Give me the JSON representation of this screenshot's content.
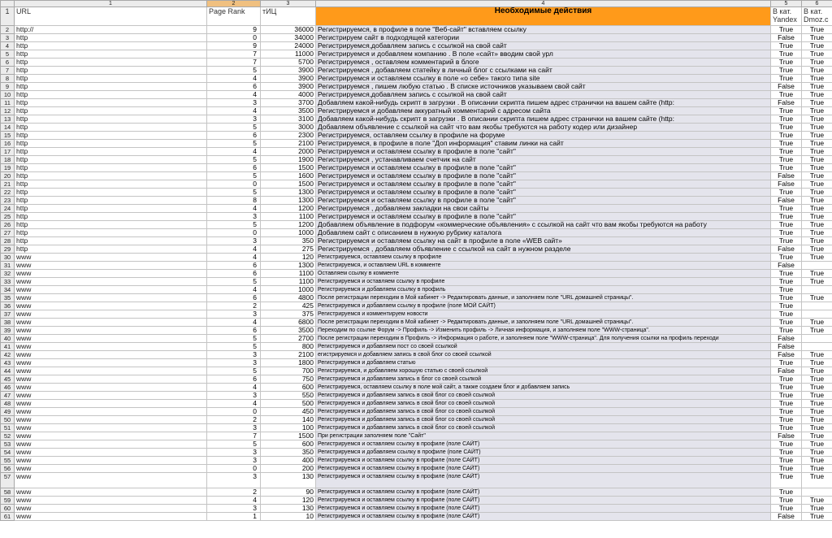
{
  "column_numbers": [
    "1",
    "2",
    "3",
    "4",
    "5",
    "6"
  ],
  "headers": {
    "url": "URL",
    "pagerank": "Page Rank",
    "tic": "тИЦ",
    "actions": "Необходимые действия",
    "yandex": "В кат. Yandex",
    "dmoz": "В кат. Dmoz.c"
  },
  "rows": [
    {
      "n": "2",
      "url": "http://",
      "pr": "9",
      "tic": "36000",
      "act": "Регистрируемся, в профиле в поле \"Веб-сайт\" вставляем ссылку",
      "y": "True",
      "d": "True",
      "small": false
    },
    {
      "n": "3",
      "url": "http",
      "pr": "0",
      "tic": "34000",
      "act": "Регистрируем сайт в подходящей категории",
      "y": "False",
      "d": "True",
      "small": false
    },
    {
      "n": "4",
      "url": "http",
      "pr": "9",
      "tic": "24000",
      "act": "Регистрируемся,добавляем запись с ссылкой на свой сайт",
      "y": "True",
      "d": "True",
      "small": false
    },
    {
      "n": "5",
      "url": "http",
      "pr": "7",
      "tic": "11000",
      "act": "Регистрируемся и добавляем компанию . В поле «сайт» вводим свой урл",
      "y": "True",
      "d": "True",
      "small": false
    },
    {
      "n": "6",
      "url": "http",
      "pr": "7",
      "tic": "5700",
      "act": "Регистрируемся , оставляем комментарий в блоге",
      "y": "True",
      "d": "True",
      "small": false
    },
    {
      "n": "7",
      "url": "http",
      "pr": "5",
      "tic": "3900",
      "act": "Регистрируемся , добавляем статейку в личный блог с ссылками на сайт",
      "y": "True",
      "d": "True",
      "small": false
    },
    {
      "n": "8",
      "url": "http",
      "pr": "4",
      "tic": "3900",
      "act": "Регистрируемся и оставляем ссылку в поле «о себе» такого типа site",
      "y": "True",
      "d": "True",
      "small": false
    },
    {
      "n": "9",
      "url": "http",
      "pr": "6",
      "tic": "3900",
      "act": "Регистрируемся , пишем любую статью . В списке источников указываем свой сайт",
      "y": "False",
      "d": "True",
      "small": false
    },
    {
      "n": "10",
      "url": "http",
      "pr": "4",
      "tic": "4000",
      "act": " Регистрируемся,добавляем запись с ссылкой на свой сайт",
      "y": "True",
      "d": "True",
      "small": false
    },
    {
      "n": "11",
      "url": "http",
      "pr": "3",
      "tic": "3700",
      "act": "Добавляем какой-нибудь скрипт в загрузки . В описании скрипта пишем адрес странички на вашем сайте (http:",
      "y": "False",
      "d": "True",
      "small": false
    },
    {
      "n": "12",
      "url": "http",
      "pr": "4",
      "tic": "3500",
      "act": "Регистрируемся и добавляем аккуратный комментарий с адресом сайта",
      "y": "True",
      "d": "True",
      "small": false
    },
    {
      "n": "13",
      "url": "http",
      "pr": "3",
      "tic": "3100",
      "act": "Добавляем какой-нибудь скрипт в загрузки . В описании скрипта пишем адрес странички на вашем сайте (http:",
      "y": "True",
      "d": "True",
      "small": false
    },
    {
      "n": "14",
      "url": "http",
      "pr": "5",
      "tic": "3000",
      "act": "Добавляем объявление с ссылкой на сайт что вам якобы требуются на работу кодер или дизайнер",
      "y": "True",
      "d": "True",
      "small": false
    },
    {
      "n": "15",
      "url": "http",
      "pr": "6",
      "tic": "2300",
      "act": "Регистрируемся, оставляем ссылку в профиле на форуме",
      "y": "True",
      "d": "True",
      "small": false
    },
    {
      "n": "16",
      "url": "http",
      "pr": "5",
      "tic": "2100",
      "act": "Регистрируемся, в профиле в поле \"Доп информация\" ставим линки на сайт",
      "y": "True",
      "d": "True",
      "small": false
    },
    {
      "n": "17",
      "url": "http",
      "pr": "4",
      "tic": "2000",
      "act": "Регистрируемся и оставляем ссылку в профиле в поле \"сайт\"",
      "y": "True",
      "d": "True",
      "small": false
    },
    {
      "n": "18",
      "url": "http",
      "pr": "5",
      "tic": "1900",
      "act": "Регистрируемся , устанавливаем счетчик на сайт",
      "y": "True",
      "d": "True",
      "small": false
    },
    {
      "n": "19",
      "url": "http",
      "pr": "6",
      "tic": "1500",
      "act": "Регистрируемся и оставляем ссылку в профиле в поле \"сайт\"",
      "y": "True",
      "d": "True",
      "small": false
    },
    {
      "n": "20",
      "url": "http",
      "pr": "5",
      "tic": "1600",
      "act": " Регистрируемся и оставляем ссылку в профиле в поле \"сайт\"",
      "y": "False",
      "d": "True",
      "small": false
    },
    {
      "n": "21",
      "url": "http",
      "pr": "0",
      "tic": "1500",
      "act": "Регистрируемся и оставляем ссылку в профиле в поле \"сайт\"",
      "y": "False",
      "d": "True",
      "small": false
    },
    {
      "n": "22",
      "url": "http",
      "pr": "5",
      "tic": "1300",
      "act": "Регистрируемся и оставляем ссылку в профиле в поле \"сайт\"",
      "y": "True",
      "d": "True",
      "small": false
    },
    {
      "n": "23",
      "url": "http",
      "pr": "8",
      "tic": "1300",
      "act": "Регистрируемся и оставляем ссылку в профиле в поле \"сайт\"",
      "y": "False",
      "d": "True",
      "small": false
    },
    {
      "n": "24",
      "url": "http",
      "pr": "4",
      "tic": "1200",
      "act": "Регистрируемся , добавляем закладки на свои сайты",
      "y": "True",
      "d": "True",
      "small": false
    },
    {
      "n": "25",
      "url": "http",
      "pr": "3",
      "tic": "1100",
      "act": "Регистрируемся и оставляем ссылку в профиле в поле \"сайт\"",
      "y": "True",
      "d": "True",
      "small": false
    },
    {
      "n": "26",
      "url": "http",
      "pr": "5",
      "tic": "1200",
      "act": "Добавляем объявление в подфорум «коммерческие объявления» с ссылкой на сайт что вам якобы требуются на работу",
      "y": "True",
      "d": "True",
      "small": false
    },
    {
      "n": "27",
      "url": "http",
      "pr": "0",
      "tic": "1000",
      "act": " Добавляем сайт с описанием в нужную рубрику каталога",
      "y": "True",
      "d": "True",
      "small": false
    },
    {
      "n": "28",
      "url": "http",
      "pr": "3",
      "tic": "350",
      "act": "Регистрируемся и оставляем ссылку на сайт в профиле в поле «WEB сайт»",
      "y": "True",
      "d": "True",
      "small": false
    },
    {
      "n": "29",
      "url": "http",
      "pr": "4",
      "tic": "275",
      "act": "Регистрируемся , добавляем объявление с ссылкой на сайт в нужном разделе",
      "y": "False",
      "d": "True",
      "small": false
    },
    {
      "n": "30",
      "url": "www",
      "pr": "4",
      "tic": "120",
      "act": "Регистрируемся, оставляем ссылку в профиле",
      "y": "True",
      "d": "True",
      "small": true
    },
    {
      "n": "31",
      "url": "www",
      "pr": "6",
      "tic": "1300",
      "act": "Регистрируемся, и оставляем URL в комменте",
      "y": "False",
      "d": "",
      "small": true
    },
    {
      "n": "32",
      "url": "www",
      "pr": "6",
      "tic": "1100",
      "act": "Оставляем ссылку в комменте",
      "y": "True",
      "d": "True",
      "small": true
    },
    {
      "n": "33",
      "url": "www",
      "pr": "5",
      "tic": "1100",
      "act": "Регистрируемся и оставляем ссылку в профиле",
      "y": "True",
      "d": "True",
      "small": true
    },
    {
      "n": "34",
      "url": "www",
      "pr": "4",
      "tic": "1000",
      "act": "Регистрируемся и добавляем ссылку в профиль",
      "y": "True",
      "d": "",
      "small": true
    },
    {
      "n": "35",
      "url": "www",
      "pr": "6",
      "tic": "4800",
      "act": "После регистрации переходим в Мой кабинет -> Редактировать данные, и заполняем поле \"URL домашней страницы\".",
      "y": "True",
      "d": "True",
      "small": true
    },
    {
      "n": "36",
      "url": "www",
      "pr": "2",
      "tic": "425",
      "act": "Регистрируемся и добавляем ссылку в профиле (поле МОЙ САЙТ)",
      "y": "True",
      "d": "",
      "small": true
    },
    {
      "n": "37",
      "url": "www",
      "pr": "3",
      "tic": "375",
      "act": "Регистрируемся и комментируем новости",
      "y": "True",
      "d": "",
      "small": true
    },
    {
      "n": "38",
      "url": "www",
      "pr": "4",
      "tic": "6800",
      "act": "После регистрации переходим в Мой кабинет -> Редактировать данные, и заполняем поле \"URL домашней страницы\".",
      "y": "True",
      "d": "True",
      "small": true
    },
    {
      "n": "39",
      "url": "www",
      "pr": "6",
      "tic": "3500",
      "act": "Переходим по ссылке Форум -> Профиль -> Изменить профиль -> Личная информация, и заполняем поле \"WWW-страница\".",
      "y": "True",
      "d": "True",
      "small": true
    },
    {
      "n": "40",
      "url": "www",
      "pr": "5",
      "tic": "2700",
      "act": "После регистрации переходим в Профиль -> Информация о работе, и заполняем поле \"WWW-страница\". Для получения ссылки на профиль переходи",
      "y": "False",
      "d": "",
      "small": true
    },
    {
      "n": "41",
      "url": "www",
      "pr": "5",
      "tic": "800",
      "act": "Регистрируемся и добавляем пост со своей ссылкой",
      "y": "False",
      "d": "",
      "small": true
    },
    {
      "n": "42",
      "url": "www",
      "pr": "3",
      "tic": "2100",
      "act": "егистрируемся и добавляем запись в свой блог со своей ссылкой",
      "y": "False",
      "d": "True",
      "small": true
    },
    {
      "n": "43",
      "url": "www",
      "pr": "3",
      "tic": "1800",
      "act": "Регистрируемся и добавляем статью",
      "y": "True",
      "d": "True",
      "small": true
    },
    {
      "n": "44",
      "url": "www",
      "pr": "5",
      "tic": "700",
      "act": "Регистрируемся, и добавляем хорошую статью с своей ссылкой",
      "y": "False",
      "d": "True",
      "small": true
    },
    {
      "n": "45",
      "url": "www",
      "pr": "6",
      "tic": "750",
      "act": "Регистрируемся и добавляем запись в блог со своей ссылкой",
      "y": "True",
      "d": "True",
      "small": true
    },
    {
      "n": "46",
      "url": "www",
      "pr": "4",
      "tic": "600",
      "act": "Регистрируемся, оставляем ссылку в поле мой сайт, а также создаем блог и добавляем запись",
      "y": "True",
      "d": "True",
      "small": true
    },
    {
      "n": "47",
      "url": "www",
      "pr": "3",
      "tic": "550",
      "act": "Регистрируемся и добавляем запись в свой блог со своей ссылкой",
      "y": "True",
      "d": "True",
      "small": true
    },
    {
      "n": "48",
      "url": "www",
      "pr": "4",
      "tic": "500",
      "act": "Регистрируемся и добавляем запись в свой блог со своей ссылкой",
      "y": "True",
      "d": "True",
      "small": true
    },
    {
      "n": "49",
      "url": "www",
      "pr": "0",
      "tic": "450",
      "act": "Регистрируемся и добавляем запись в свой блог со своей ссылкой",
      "y": "True",
      "d": "True",
      "small": true
    },
    {
      "n": "50",
      "url": "www",
      "pr": "2",
      "tic": "140",
      "act": "Регистрируемся и добавляем запись в свой блог со своей ссылкой",
      "y": "True",
      "d": "True",
      "small": true
    },
    {
      "n": "51",
      "url": "www",
      "pr": "3",
      "tic": "100",
      "act": "Регистрируемся и добавляем запись в свой блог со своей ссылкой",
      "y": "True",
      "d": "True",
      "small": true
    },
    {
      "n": "52",
      "url": "www",
      "pr": "7",
      "tic": "1500",
      "act": "При регистрации заполняем поле \"Сайт\"",
      "y": "False",
      "d": "True",
      "small": true
    },
    {
      "n": "53",
      "url": "www",
      "pr": "5",
      "tic": "600",
      "act": "Регистрируемся и оставляем ссылку в профиле (поле САЙТ)",
      "y": "True",
      "d": "True",
      "small": true
    },
    {
      "n": "54",
      "url": "www",
      "pr": "3",
      "tic": "350",
      "act": "Регистрируемся и добавляем ссылку в профиле (поле САЙТ)",
      "y": "True",
      "d": "True",
      "small": true
    },
    {
      "n": "55",
      "url": "www",
      "pr": "3",
      "tic": "400",
      "act": "Регистрируемся и оставляем ссылку в профиле (поле САЙТ)",
      "y": "True",
      "d": "True",
      "small": true
    },
    {
      "n": "56",
      "url": "www",
      "pr": "0",
      "tic": "200",
      "act": "Регистрируемся и оставляем ссылку в профиле (поле САЙТ)",
      "y": "True",
      "d": "True",
      "small": true
    },
    {
      "n": "57",
      "url": "www",
      "pr": "3",
      "tic": "130",
      "act": "Регистрируемся и оставляем ссылку в профиле (поле САЙТ)",
      "y": "True",
      "d": "True",
      "small": true,
      "tall": true
    },
    {
      "n": "58",
      "url": "www",
      "pr": "2",
      "tic": "90",
      "act": "Регистрируемся и оставляем ссылку в профиле (поле САЙТ)",
      "y": "True",
      "d": "",
      "small": true
    },
    {
      "n": "59",
      "url": "www",
      "pr": "4",
      "tic": "120",
      "act": "Регистрируемся и оставляем ссылку в профиле (поле САЙТ)",
      "y": "True",
      "d": "True",
      "small": true
    },
    {
      "n": "60",
      "url": "www",
      "pr": "3",
      "tic": "130",
      "act": "Регистрируемся и оставляем ссылку в профиле (поле САЙТ)",
      "y": "True",
      "d": "True",
      "small": true
    },
    {
      "n": "61",
      "url": "www",
      "pr": "1",
      "tic": "10",
      "act": "Регистрируемся и оставляем ссылку в профиле (поле САЙТ)",
      "y": "False",
      "d": "True",
      "small": true
    }
  ]
}
